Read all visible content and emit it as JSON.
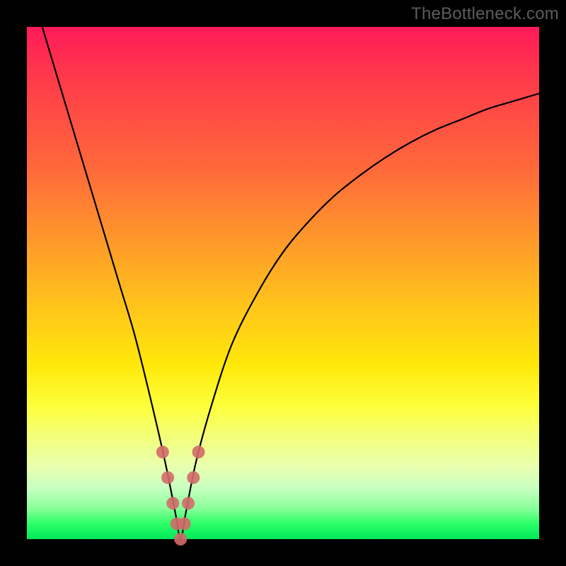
{
  "watermark": "TheBottleneck.com",
  "colors": {
    "curve_stroke": "#000000",
    "marker_stroke": "#d26a6a",
    "marker_fill": "#d26a6a"
  },
  "chart_data": {
    "type": "line",
    "title": "",
    "xlabel": "",
    "ylabel": "",
    "xlim": [
      0,
      100
    ],
    "ylim": [
      0,
      100
    ],
    "grid": false,
    "legend": false,
    "series": [
      {
        "name": "bottleneck-curve",
        "x": [
          3,
          6,
          9,
          12,
          15,
          18,
          21,
          24,
          27,
          29,
          30,
          31,
          33,
          36,
          40,
          45,
          50,
          55,
          60,
          65,
          70,
          75,
          80,
          85,
          90,
          95,
          100
        ],
        "y": [
          100,
          90,
          80,
          70,
          60,
          50,
          40,
          28,
          15,
          5,
          0,
          5,
          15,
          26,
          38,
          48,
          56,
          62,
          67,
          71,
          74.5,
          77.5,
          80,
          82,
          84,
          85.5,
          87
        ]
      }
    ],
    "markers": {
      "name": "minimum-region",
      "x": [
        26.5,
        27.5,
        28.5,
        29.25,
        30,
        30.75,
        31.5,
        32.5,
        33.5
      ],
      "y": [
        17,
        12,
        7,
        3,
        0,
        3,
        7,
        12,
        17
      ]
    }
  }
}
